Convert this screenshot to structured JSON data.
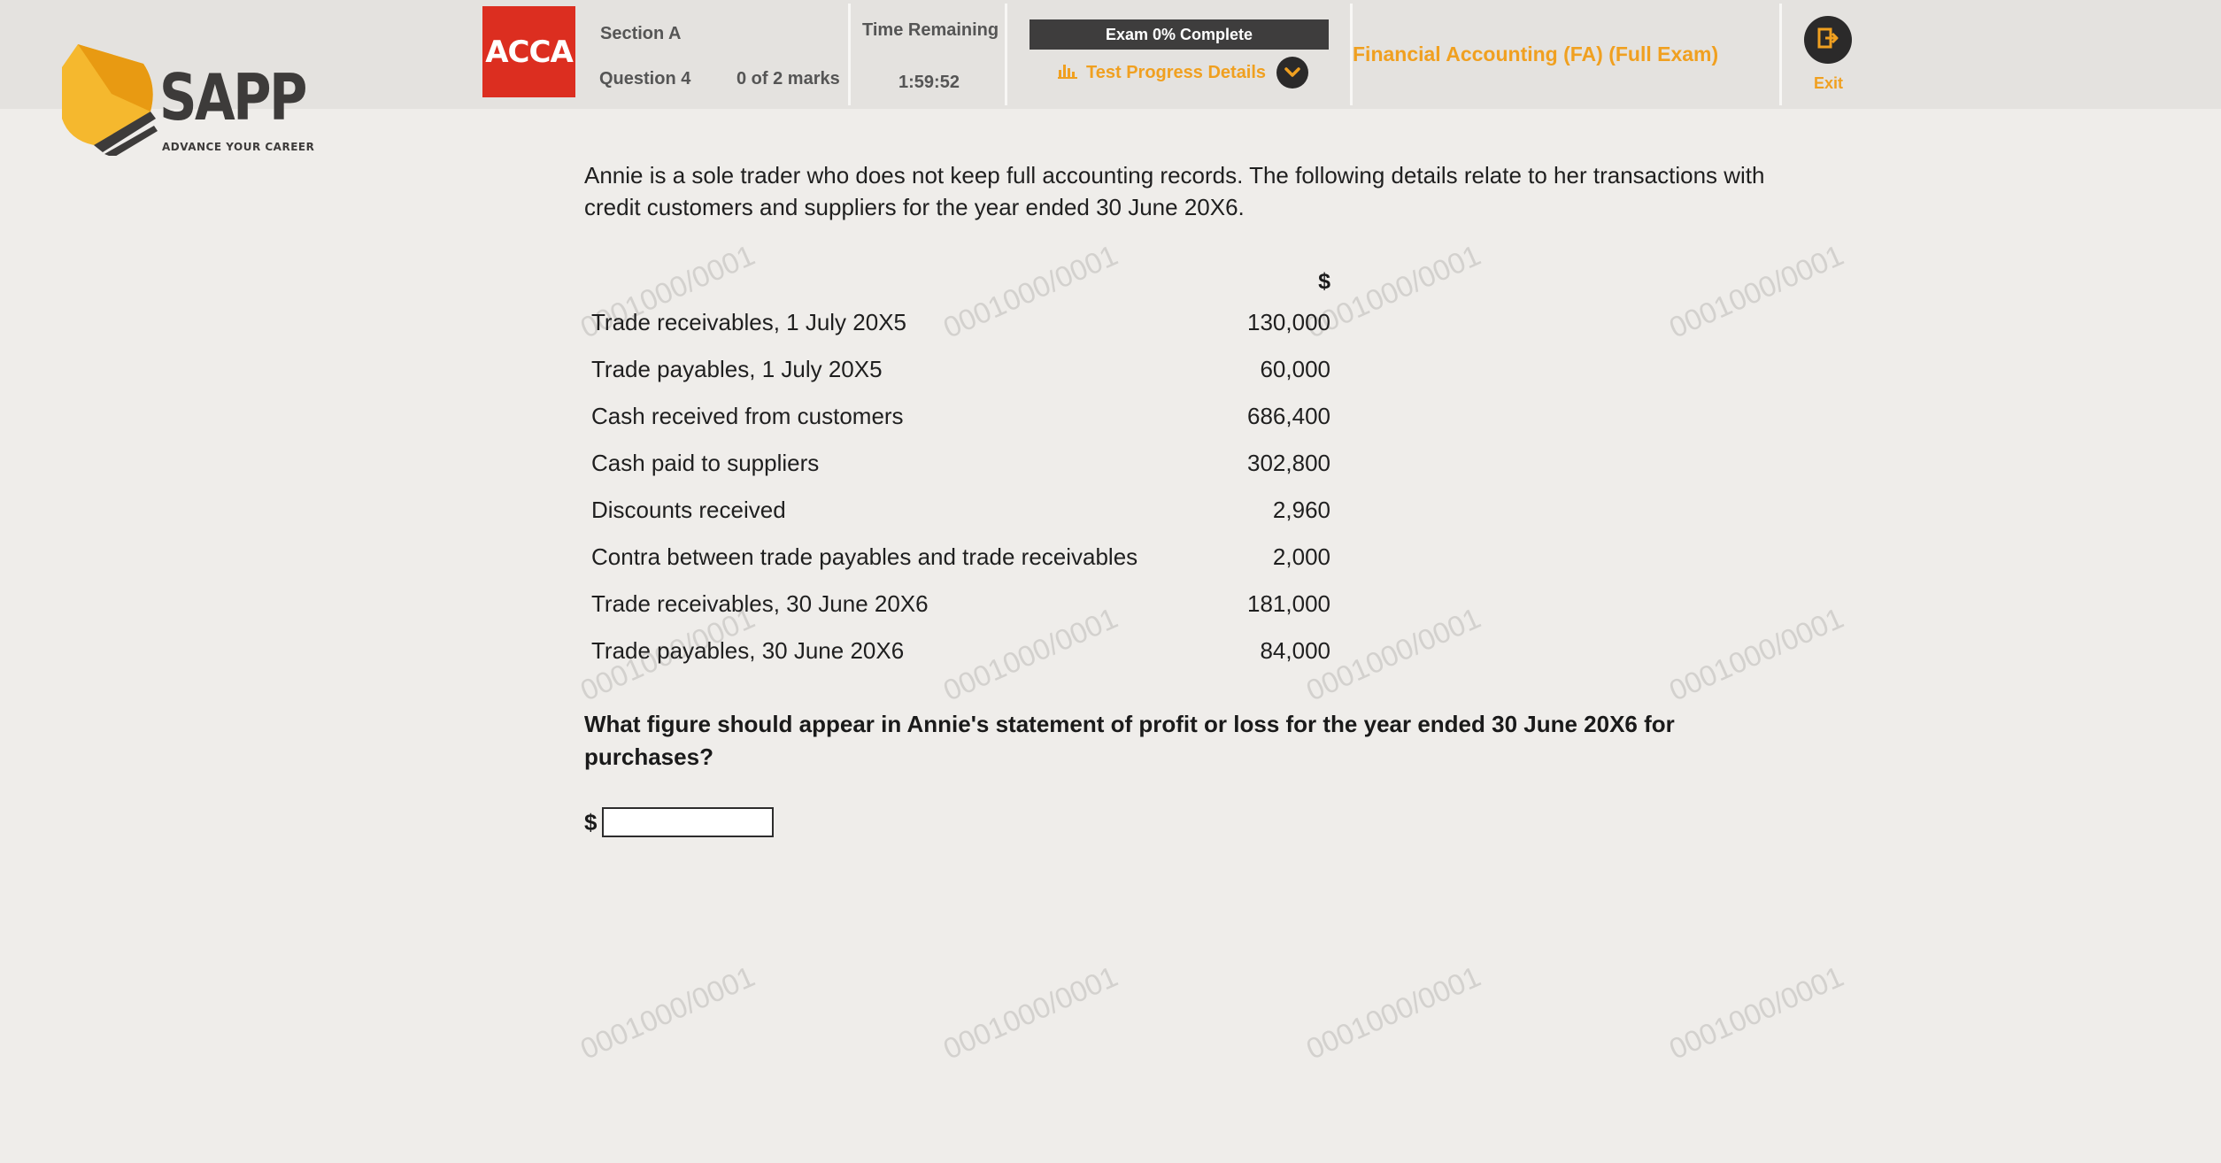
{
  "brand": {
    "name": "SAPP",
    "tagline": "ADVANCE YOUR CAREER",
    "accent": "#f0a020",
    "logo_yellow": "#f5b82e"
  },
  "acca": {
    "label": "ACCA",
    "color": "#dc2e20"
  },
  "header": {
    "section": "Section A",
    "question": "Question 4",
    "marks": "0 of 2 marks",
    "time_label": "Time Remaining",
    "time_value": "1:59:52",
    "progress_label": "Exam 0% Complete",
    "progress_percent": 0,
    "progress_details": "Test Progress Details",
    "exam_title": "Financial Accounting (FA) (Full Exam)",
    "exit_label": "Exit"
  },
  "watermark": "0001000/0001",
  "content": {
    "intro": "Annie is a sole trader who does not keep full accounting records. The following details relate to her transactions with credit customers and suppliers for the year ended 30 June 20X6.",
    "currency_header": "$",
    "rows": [
      {
        "label": "Trade receivables, 1 July 20X5",
        "value": "130,000"
      },
      {
        "label": "Trade payables, 1 July 20X5",
        "value": "60,000"
      },
      {
        "label": "Cash received from customers",
        "value": "686,400"
      },
      {
        "label": "Cash paid to suppliers",
        "value": "302,800"
      },
      {
        "label": "Discounts received",
        "value": "2,960"
      },
      {
        "label": "Contra between trade payables and trade receivables",
        "value": "2,000"
      },
      {
        "label": "Trade receivables, 30 June 20X6",
        "value": "181,000"
      },
      {
        "label": "Trade payables, 30 June 20X6",
        "value": "84,000"
      }
    ],
    "question": "What figure should appear in Annie's statement of profit or loss for the year ended 30 June 20X6 for purchases?",
    "answer_currency": "$",
    "answer_value": ""
  }
}
